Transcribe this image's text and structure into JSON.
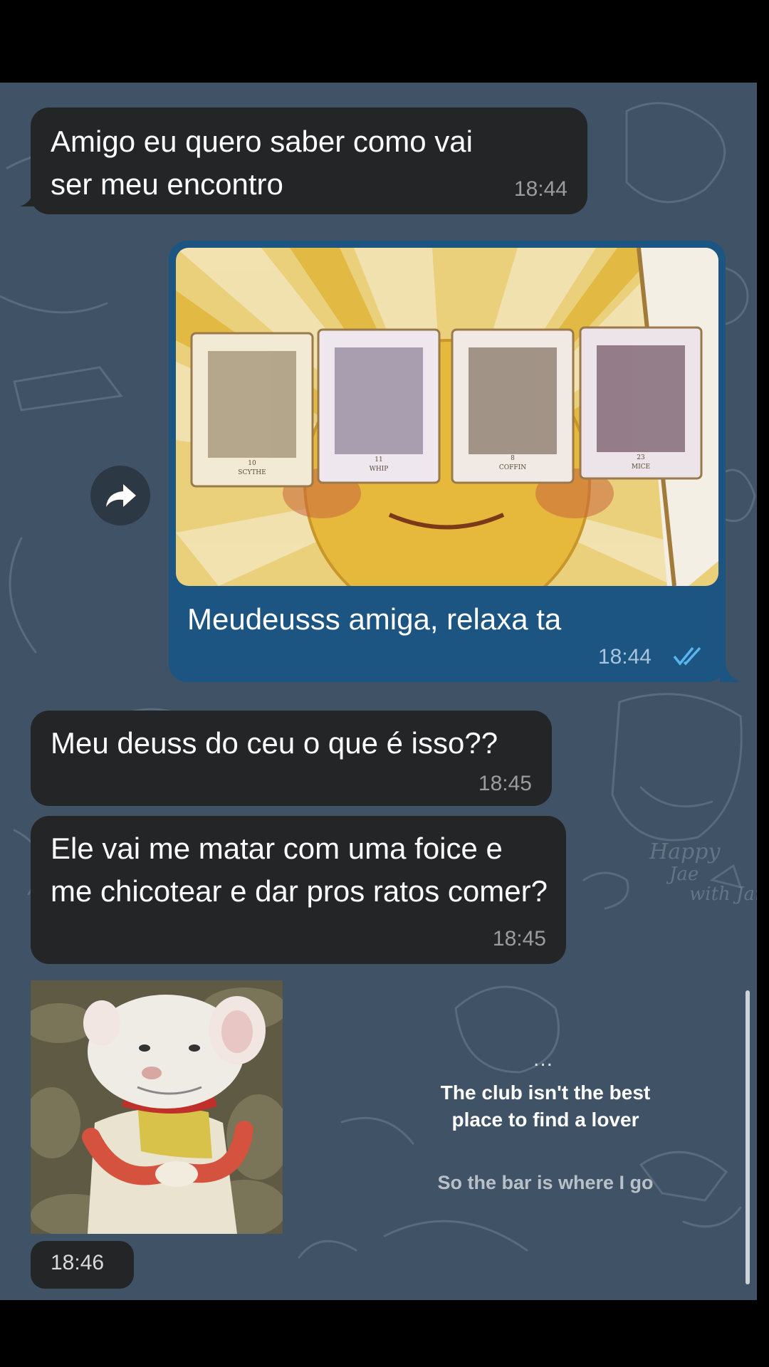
{
  "messages": [
    {
      "text": "Amigo eu quero saber como vai ser meu encontro",
      "time": "18:44"
    },
    {
      "text": "Meudeusss amiga, relaxa ta",
      "time": "18:44",
      "card_labels": [
        "SCYTHE",
        "WHIP",
        "COFFIN",
        "MICE"
      ],
      "card_numbers": [
        "10",
        "11",
        "8",
        "23"
      ]
    },
    {
      "text": "Meu deuss do ceu o que é isso??",
      "time": "18:45"
    },
    {
      "text": "Ele vai me matar com uma foice e me chicotear e dar pros ratos comer?",
      "time": "18:45"
    },
    {
      "time": "18:46"
    }
  ],
  "story": {
    "dots": "...",
    "main": "The club isn't the best place to find a lover",
    "sub": "So the bar is where I go"
  },
  "background_doodle_text": {
    "line1": "Happy",
    "line2": "Jae",
    "line3": "with Jar"
  },
  "colors": {
    "chat_background": "#3f5266",
    "incoming_bubble": "#242526",
    "outgoing_bubble": "#1d5582",
    "read_check": "#5ab4f0"
  },
  "icons": [
    "forward-arrow-icon",
    "double-check-icon",
    "bubble-tail"
  ]
}
